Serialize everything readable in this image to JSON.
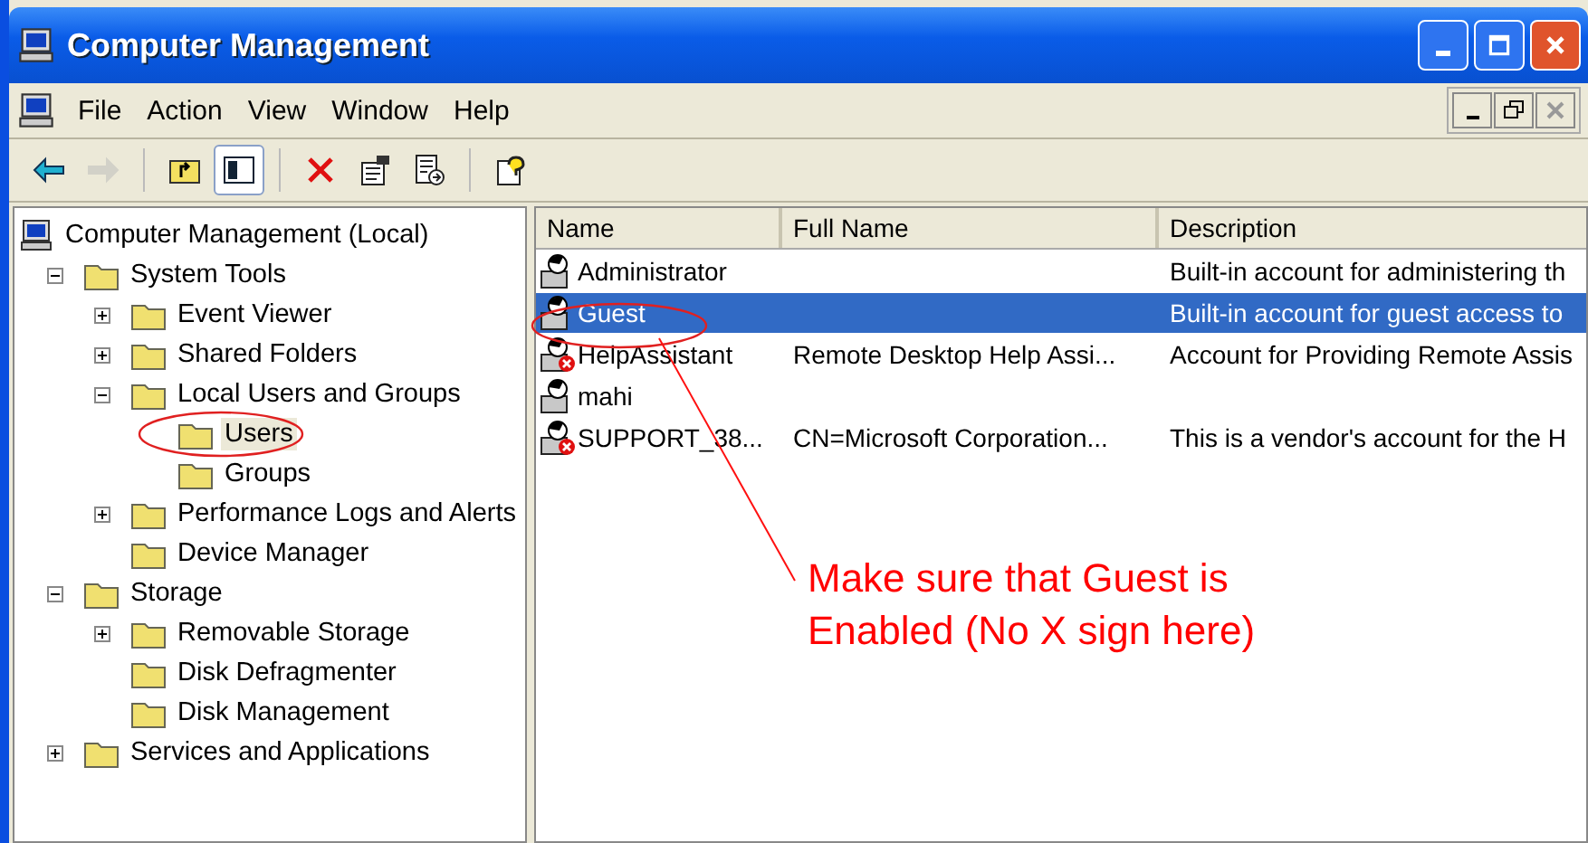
{
  "window": {
    "title": "Computer Management"
  },
  "menu": [
    "File",
    "Action",
    "View",
    "Window",
    "Help"
  ],
  "toolbar_buttons": [
    {
      "disabled": false,
      "pressed": false
    },
    {
      "disabled": true,
      "pressed": false
    },
    {
      "disabled": false,
      "pressed": false
    },
    {
      "disabled": false,
      "pressed": true
    },
    {
      "disabled": false,
      "pressed": false
    },
    {
      "disabled": false,
      "pressed": false
    },
    {
      "disabled": false,
      "pressed": false
    },
    {
      "disabled": false,
      "pressed": false
    }
  ],
  "tree": [
    {
      "label": "Computer Management (Local)",
      "selected": false,
      "children": [
        {
          "label": "System Tools",
          "expanded": true,
          "selected": false,
          "children": [
            {
              "label": "Event Viewer",
              "expanded": false,
              "selected": false
            },
            {
              "label": "Shared Folders",
              "expanded": false,
              "selected": false
            },
            {
              "label": "Local Users and Groups",
              "expanded": true,
              "selected": false,
              "children": [
                {
                  "label": "Users",
                  "selected": true
                },
                {
                  "label": "Groups",
                  "selected": false
                }
              ]
            },
            {
              "label": "Performance Logs and Alerts",
              "expanded": false,
              "selected": false
            },
            {
              "label": "Device Manager",
              "selected": false
            }
          ]
        },
        {
          "label": "Storage",
          "expanded": true,
          "selected": false,
          "children": [
            {
              "label": "Removable Storage",
              "expanded": false,
              "selected": false
            },
            {
              "label": "Disk Defragmenter",
              "selected": false
            },
            {
              "label": "Disk Management",
              "selected": false
            }
          ]
        },
        {
          "label": "Services and Applications",
          "expanded": false,
          "selected": false
        }
      ]
    }
  ],
  "table": {
    "columns": [
      "Name",
      "Full Name",
      "Description"
    ],
    "rows": [
      {
        "name": "Administrator",
        "full_name": "",
        "description": "Built-in account for administering th",
        "disabled": false,
        "selected": false
      },
      {
        "name": "Guest",
        "full_name": "",
        "description": "Built-in account for guest access to",
        "disabled": false,
        "selected": true
      },
      {
        "name": "HelpAssistant",
        "full_name": "Remote Desktop Help Assi...",
        "description": "Account for Providing Remote Assis",
        "disabled": true,
        "selected": false
      },
      {
        "name": "mahi",
        "full_name": "",
        "description": "",
        "disabled": false,
        "selected": false
      },
      {
        "name": "SUPPORT_38...",
        "full_name": "CN=Microsoft Corporation...",
        "description": "This is a vendor's account for the H",
        "disabled": true,
        "selected": false
      }
    ]
  },
  "annotation": {
    "lines": [
      "Make sure that Guest is",
      "Enabled (No X sign here)"
    ]
  }
}
